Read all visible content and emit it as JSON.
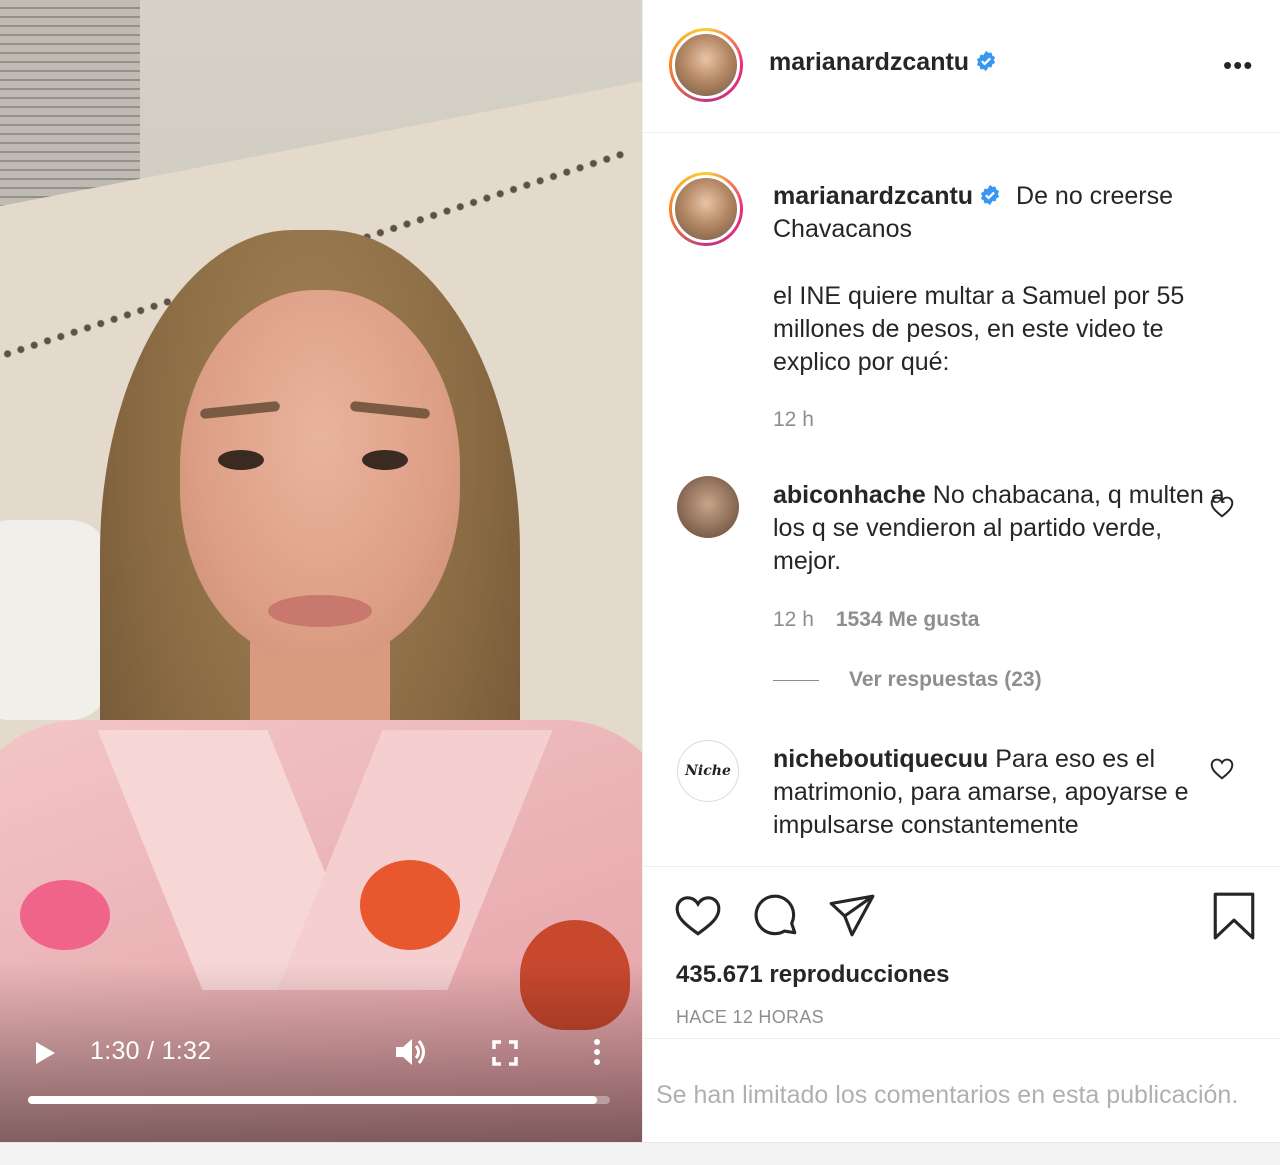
{
  "video": {
    "current_time": "1:30",
    "duration": "1:32",
    "time_separator": " / ",
    "progress": 0.978
  },
  "post": {
    "username": "marianardzcantu",
    "verified": true,
    "more_label": "•••",
    "caption_lines": [
      "De no creerse",
      "Chavacanos"
    ],
    "caption_body": "el INE quiere multar a Samuel por 55 millones de pesos, en este video te explico por qué:",
    "caption_age": "12 h"
  },
  "comments": [
    {
      "username": "abiconhache",
      "text": "No chabacana, q multen a los q se vendieron al partido verde, mejor.",
      "age": "12 h",
      "likes": "1534 Me gusta",
      "replies_label": "Ver respuestas (23)"
    },
    {
      "username": "nicheboutiquecuu",
      "avatar_text": "Niche",
      "text": "Para eso es el matrimonio, para amarse, apoyarse e impulsarse constantemente"
    }
  ],
  "stats": {
    "views": "435.671 reproducciones",
    "posted": "HACE 12 HORAS"
  },
  "footer": {
    "comments_limited": "Se han limitado los comentarios en esta publicación."
  },
  "icons": [
    "play-icon",
    "volume-icon",
    "fullscreen-icon",
    "more-vertical-icon",
    "verified-icon",
    "heart-icon",
    "comment-icon",
    "share-icon",
    "bookmark-icon"
  ],
  "colors": {
    "verified_blue": "#3897f0",
    "text": "#262626",
    "muted": "#8e8e8e"
  }
}
